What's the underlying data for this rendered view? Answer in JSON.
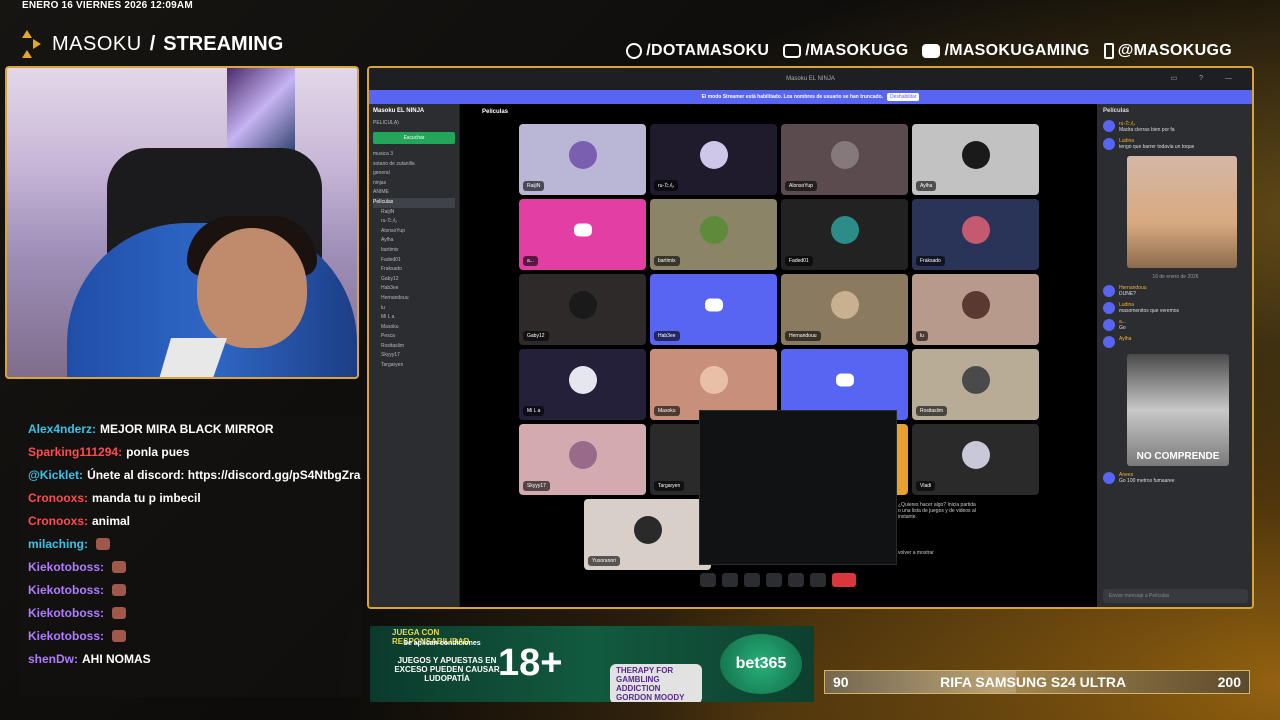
{
  "date": "ENERO 16 VIERNES 2026 12:09AM",
  "brand": {
    "name": "MASOKU",
    "sep": "/",
    "section": "STREAMING"
  },
  "socials": [
    {
      "icon": "facebook-icon",
      "text": "/DOTAMASOKU"
    },
    {
      "icon": "instagram-icon",
      "text": "/MASOKUGG"
    },
    {
      "icon": "youtube-icon",
      "text": "/MASOKUGAMING"
    },
    {
      "icon": "tiktok-icon",
      "text": "@MASOKUGG"
    }
  ],
  "chat": [
    {
      "user": "Alex4nderz:",
      "text": "MEJOR MIRA BLACK MIRROR",
      "color": "#37c3ea"
    },
    {
      "user": "Sparking111294:",
      "text": "ponla pues",
      "color": "#ff4c4c"
    },
    {
      "user": "@Kicklet:",
      "text": "Únete al discord: https://discord.gg/pS4NtbgZra",
      "color": "#37c3ea"
    },
    {
      "user": "Cronooxs:",
      "text": "manda tu p imbecil",
      "color": "#ff4c4c"
    },
    {
      "user": "Cronooxs:",
      "text": "animal",
      "color": "#ff4c4c"
    },
    {
      "user": "milaching:",
      "text": "",
      "color": "#37c3ea"
    },
    {
      "user": "Kiekotoboss:",
      "text": "",
      "color": "#b07cff"
    },
    {
      "user": "Kiekotoboss:",
      "text": "",
      "color": "#b07cff"
    },
    {
      "user": "Kiekotoboss:",
      "text": "",
      "color": "#b07cff"
    },
    {
      "user": "Kiekotoboss:",
      "text": "",
      "color": "#b07cff"
    },
    {
      "user": "shenDw:",
      "text": "AHI NOMAS",
      "color": "#b07cff"
    }
  ],
  "ad": {
    "line1": "JUEGA CON RESPONSABILIDAD",
    "line2": "Se aplican condiciones",
    "line3": "JUEGOS Y APUESTAS EN EXCESO PUEDEN CAUSAR LUDOPATÍA",
    "age": "18+",
    "therapy": "THERAPY FOR GAMBLING ADDICTION GORDON MOODY",
    "brand": "bet365"
  },
  "raffle": {
    "min": "90",
    "title": "RIFA SAMSUNG S24 ULTRA",
    "max": "200",
    "progress": 0.45
  },
  "discord": {
    "window_title": "Masoku EL NINJA",
    "banner": "El modo Streamer está habilitado. Los nombres de usuario se han truncado.",
    "banner_btn": "Deshabilitar",
    "server": "Masoku EL NINJA",
    "side_event": "PELICULA)",
    "join": "Escuchar",
    "channels": [
      "musica 3",
      "sotano de zutanilla",
      "general",
      "ninjas",
      "ANIME",
      "Películas"
    ],
    "active_channel": "Películas",
    "members": [
      "RaijiN",
      "ru-たん",
      "AlonsoYup",
      "Aylha",
      "bartimix",
      "Faded01",
      "Fraksado",
      "Gaby12",
      "Hab3ee",
      "Hernandouu",
      "lu",
      "Mi L a",
      "Masoku",
      "Pesca",
      "Rositaslim",
      "Skyyy17",
      "Targaryen"
    ],
    "tiles": [
      {
        "name": "RaijiN",
        "bg": "#b9b6d6",
        "type": "avatar",
        "av": "#7a5fb0"
      },
      {
        "name": "ru-たん",
        "bg": "#1f1b2c",
        "type": "avatar",
        "av": "#cfc7ea"
      },
      {
        "name": "AlonsoYup",
        "bg": "#5b4b4e",
        "type": "avatar",
        "av": "#86797b"
      },
      {
        "name": "Aylha",
        "bg": "#c3c2c2",
        "type": "avatar",
        "av": "#1a1a1a"
      },
      {
        "name": "a...",
        "bg": "#e23ea4",
        "type": "discord"
      },
      {
        "name": "bartimix",
        "bg": "#8c8466",
        "type": "avatar",
        "av": "#5f8a3a"
      },
      {
        "name": "Faded01",
        "bg": "#222222",
        "type": "avatar",
        "av": "#2c8c88"
      },
      {
        "name": "Fraksado",
        "bg": "#2a3458",
        "type": "avatar",
        "av": "#c45a70"
      },
      {
        "name": "Gaby12",
        "bg": "#2e2a2a",
        "type": "avatar",
        "av": "#1a1a1a"
      },
      {
        "name": "Hab3ee",
        "bg": "#5865f2",
        "type": "discord"
      },
      {
        "name": "Hernandouu",
        "bg": "#8a7a60",
        "type": "avatar",
        "av": "#c8b090"
      },
      {
        "name": "lu",
        "bg": "#b89a8c",
        "type": "avatar",
        "av": "#5a3a30"
      },
      {
        "name": "Mi L a",
        "bg": "#24203a",
        "type": "avatar",
        "av": "#e6e6f0"
      },
      {
        "name": "Masoku",
        "bg": "#c8907a",
        "type": "avatar",
        "av": "#e8c0a8"
      },
      {
        "name": "",
        "bg": "#5865f2",
        "type": "discord"
      },
      {
        "name": "Rositaslim",
        "bg": "#b9ac97",
        "type": "avatar",
        "av": "#4a4a4a"
      },
      {
        "name": "Skyyy17",
        "bg": "#d2aab0",
        "type": "avatar",
        "av": "#9a6a8a"
      },
      {
        "name": "Targaryen",
        "bg": "#2a2a2a",
        "type": "avatar",
        "av": "#1a1a1a"
      },
      {
        "name": "",
        "bg": "#e8a030",
        "type": "avatar",
        "av": "#e8a030"
      },
      {
        "name": "Vladi",
        "bg": "#2a2a2a",
        "type": "avatar",
        "av": "#c8c8d8"
      },
      {
        "name": "Yusoranori",
        "bg": "#d8d0c8",
        "type": "avatar",
        "av": "#2a2a2a"
      }
    ],
    "popup_text": "¿Quieres hacer algo? Inicia partida o una lista de juegos y de videos al instante.",
    "popup_back": "volver a mostrar",
    "right_title": "Películas",
    "right_msgs": [
      {
        "user": "ru-たん",
        "text": "Madra clerras bien por fa"
      },
      {
        "user": "Ludina",
        "text": "tengo que barrer todavia un toque"
      },
      {
        "user": "Hernandouu",
        "text": "DUNE?"
      },
      {
        "user": "Ludina",
        "text": "masomenitos que veremos"
      },
      {
        "user": "a...",
        "text": "Go"
      },
      {
        "user": "Aylha",
        "text": ""
      },
      {
        "user": "Anees",
        "text": "Go 100 metros fumaaree"
      }
    ],
    "date_sep": "16 de enero de 2026",
    "gif_caption": "NO COMPRENDE",
    "input_placeholder": "Enviar mensaje a Películas"
  }
}
